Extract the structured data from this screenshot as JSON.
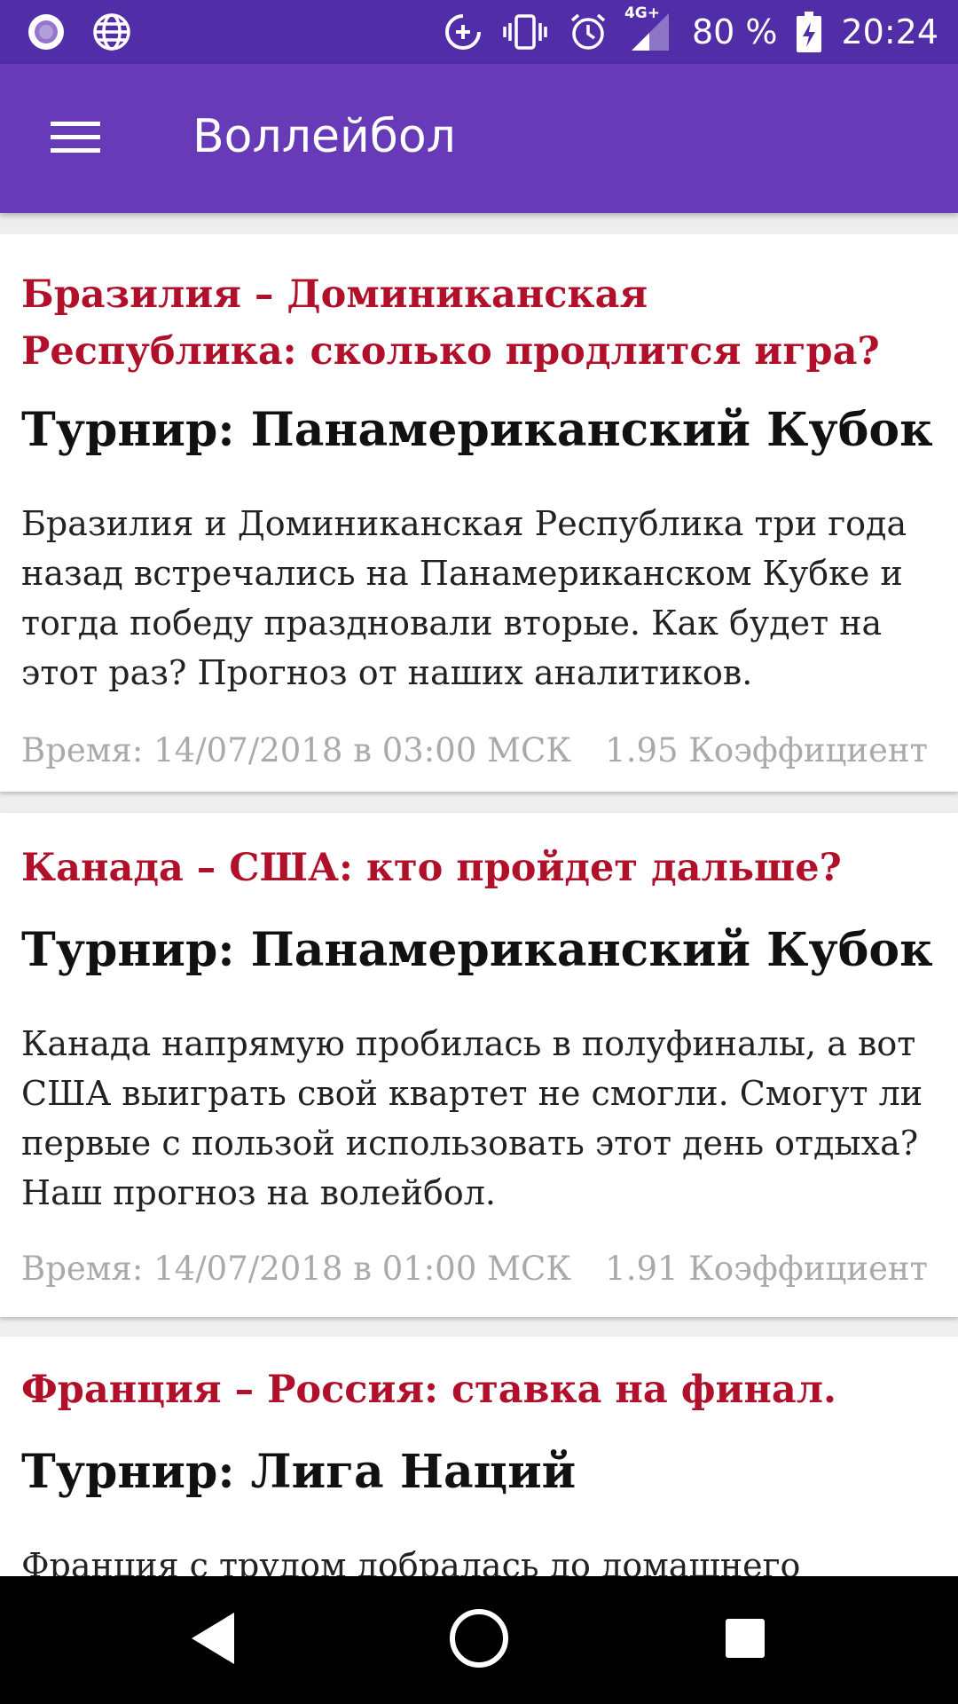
{
  "status_bar": {
    "battery": "80 %",
    "time": "20:24",
    "network": "4G+",
    "icons": [
      "notification-dot-icon",
      "globe-icon",
      "data-saver-icon",
      "vibrate-icon",
      "alarm-icon",
      "signal-icon",
      "battery-charging-icon"
    ]
  },
  "app_bar": {
    "title": "Воллейбол",
    "background": "#673ab7",
    "status_color": "#512da8"
  },
  "colors": {
    "title_red": "#b0102a",
    "muted": "#aaaaaa"
  },
  "cards": [
    {
      "title": "Бразилия – Доминиканская Республика: сколько продлится игра?",
      "tournament": "Турнир: Панамериканский Кубок",
      "description": "Бразилия и Доминиканская Республика три года назад встречались на Панамериканском Кубке и тогда победу праздновали вторые. Как будет на этот раз? Прогноз от наших аналитиков.",
      "time": "Время: 14/07/2018 в 03:00 МСК",
      "odds": "1.95 Коэффициент"
    },
    {
      "title": "Канада – США: кто пройдет дальше?",
      "tournament": "Турнир: Панамериканский Кубок",
      "description": "Канада напрямую пробилась в полуфиналы, а вот США выиграть свой квартет не смогли. Смогут ли первые с пользой использовать этот день отдыха? Наш прогноз на волейбол.",
      "time": "Время: 14/07/2018 в 01:00 МСК",
      "odds": "1.91 Коэффициент"
    },
    {
      "title": "Франция – Россия: ставка на финал.",
      "tournament": "Турнир: Лига Наций",
      "description": "Франция с трудом добралась до домашнего"
    }
  ],
  "nav": {
    "back": "back-icon",
    "home": "home-icon",
    "recents": "recents-icon"
  }
}
